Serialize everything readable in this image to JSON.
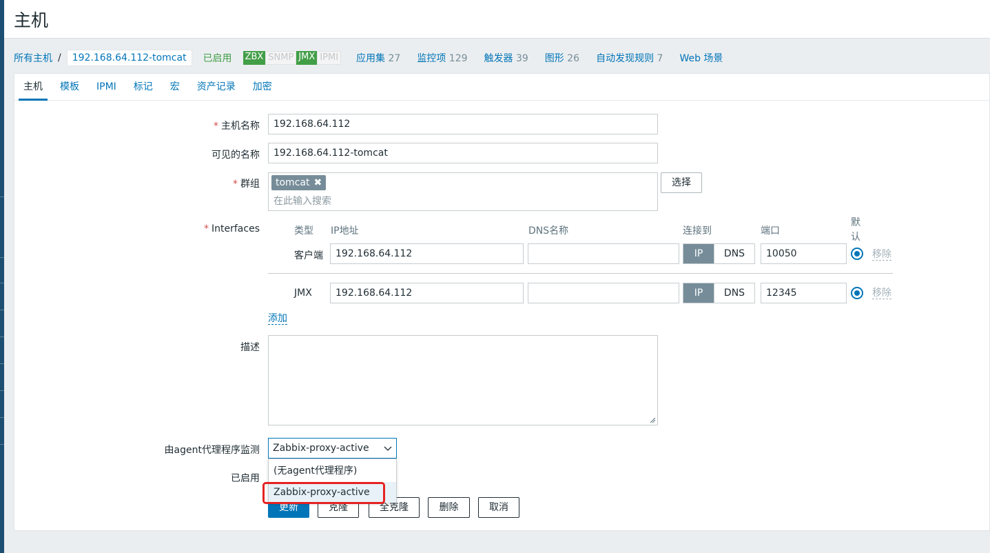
{
  "page": {
    "title": "主机"
  },
  "breadcrumb": {
    "all_hosts": "所有主机",
    "separator": "/",
    "current": "192.168.64.112-tomcat"
  },
  "host_status": "已启用",
  "availability": [
    {
      "label": "ZBX",
      "active": true
    },
    {
      "label": "SNMP",
      "active": false
    },
    {
      "label": "JMX",
      "active": true
    },
    {
      "label": "IPMI",
      "active": false
    }
  ],
  "nav": [
    {
      "label": "应用集",
      "count": "27"
    },
    {
      "label": "监控项",
      "count": "129"
    },
    {
      "label": "触发器",
      "count": "39"
    },
    {
      "label": "图形",
      "count": "26"
    },
    {
      "label": "自动发现规则",
      "count": "7"
    },
    {
      "label": "Web 场景",
      "count": ""
    }
  ],
  "tabs": [
    "主机",
    "模板",
    "IPMI",
    "标记",
    "宏",
    "资产记录",
    "加密"
  ],
  "form": {
    "required_mark": "*",
    "host_name": {
      "label": "主机名称",
      "value": "192.168.64.112"
    },
    "visible_name": {
      "label": "可见的名称",
      "value": "192.168.64.112-tomcat"
    },
    "groups": {
      "label": "群组",
      "chip": "tomcat",
      "chip_remove": "✖",
      "placeholder": "在此输入搜索",
      "select_button": "选择"
    },
    "interfaces": {
      "label": "Interfaces",
      "headers": {
        "type": "类型",
        "ip": "IP地址",
        "dns": "DNS名称",
        "connect": "连接到",
        "port": "端口",
        "default_line1": "默",
        "default_line2": "认"
      },
      "rows": [
        {
          "type": "客户端",
          "ip": "192.168.64.112",
          "dns": "",
          "connect_ip": "IP",
          "connect_dns": "DNS",
          "port": "10050",
          "remove": "移除"
        },
        {
          "type": "JMX",
          "ip": "192.168.64.112",
          "dns": "",
          "connect_ip": "IP",
          "connect_dns": "DNS",
          "port": "12345",
          "remove": "移除"
        }
      ],
      "add": "添加"
    },
    "description": {
      "label": "描述",
      "value": ""
    },
    "proxy": {
      "label": "由agent代理程序监测",
      "selected": "Zabbix-proxy-active",
      "options": [
        "(无agent代理程序)",
        "Zabbix-proxy-active"
      ]
    },
    "enabled": {
      "label": "已启用"
    },
    "buttons": {
      "update": "更新",
      "clone": "克隆",
      "full_clone": "全克隆",
      "delete": "删除",
      "cancel": "取消"
    }
  },
  "colors": {
    "accent": "#0275b8",
    "enabled": "#429e47",
    "required": "#d64e4e",
    "highlight": "#e52222"
  }
}
